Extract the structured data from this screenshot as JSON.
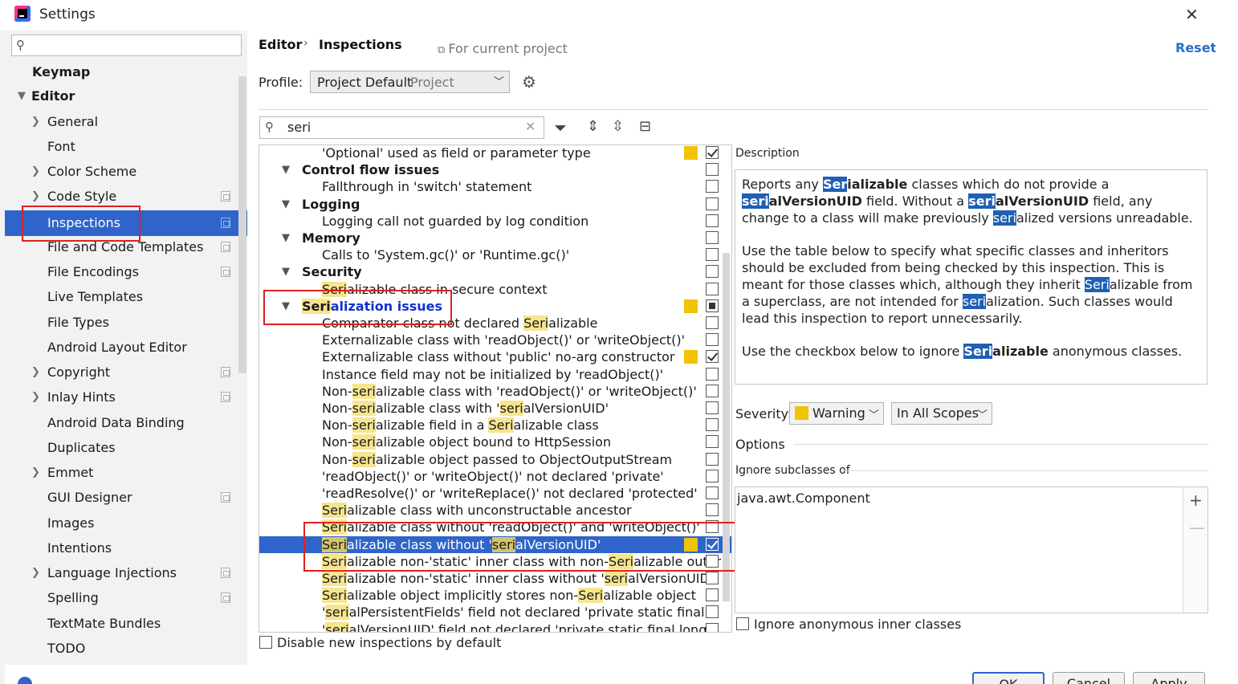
{
  "window": {
    "title": "Settings",
    "close": "✕"
  },
  "sidebar": {
    "search_placeholder": "",
    "items": [
      {
        "label": "Keymap"
      },
      {
        "label": "Editor"
      },
      {
        "label": "General"
      },
      {
        "label": "Font"
      },
      {
        "label": "Color Scheme"
      },
      {
        "label": "Code Style"
      },
      {
        "label": "Inspections"
      },
      {
        "label": "File and Code Templates"
      },
      {
        "label": "File Encodings"
      },
      {
        "label": "Live Templates"
      },
      {
        "label": "File Types"
      },
      {
        "label": "Android Layout Editor"
      },
      {
        "label": "Copyright"
      },
      {
        "label": "Inlay Hints"
      },
      {
        "label": "Android Data Binding"
      },
      {
        "label": "Duplicates"
      },
      {
        "label": "Emmet"
      },
      {
        "label": "GUI Designer"
      },
      {
        "label": "Images"
      },
      {
        "label": "Intentions"
      },
      {
        "label": "Language Injections"
      },
      {
        "label": "Spelling"
      },
      {
        "label": "TextMate Bundles"
      },
      {
        "label": "TODO"
      }
    ]
  },
  "header": {
    "breadcrumb_editor": "Editor",
    "breadcrumb_sep": "›",
    "breadcrumb_inspections": "Inspections",
    "for_current_project": "For current project",
    "reset": "Reset",
    "profile_label": "Profile:",
    "profile_value": "Project Default",
    "profile_scope": "Project"
  },
  "filter": {
    "value": "seri"
  },
  "tree": {
    "rows": [
      {
        "pre": "'Optional' used as field or parameter type",
        "hl": "",
        "post": ""
      },
      {
        "pre": "Control flow issues",
        "hl": "",
        "post": ""
      },
      {
        "pre": "Fallthrough in 'switch' statement",
        "hl": "",
        "post": ""
      },
      {
        "pre": "Logging",
        "hl": "",
        "post": ""
      },
      {
        "pre": "Logging call not guarded by log condition",
        "hl": "",
        "post": ""
      },
      {
        "pre": "Memory",
        "hl": "",
        "post": ""
      },
      {
        "pre": "Calls to 'System.gc()' or 'Runtime.gc()'",
        "hl": "",
        "post": ""
      },
      {
        "pre": "Security",
        "hl": "",
        "post": ""
      },
      {
        "pre": "",
        "hl": "Seri",
        "post": "alizable class in secure context"
      },
      {
        "pre": "",
        "hl": "Seri",
        "post": "alization issues"
      },
      {
        "pre": "Comparator class not declared ",
        "hl": "Seri",
        "post": "alizable"
      },
      {
        "pre": "Externalizable class with 'readObject()' or 'writeObject()'",
        "hl": "",
        "post": ""
      },
      {
        "pre": "Externalizable class without 'public' no-arg constructor",
        "hl": "",
        "post": ""
      },
      {
        "pre": "Instance field may not be initialized by 'readObject()'",
        "hl": "",
        "post": ""
      },
      {
        "pre": "Non-",
        "hl": "seri",
        "post": "alizable class with 'readObject()' or 'writeObject()'"
      },
      {
        "pre": "Non-",
        "hl": "seri",
        "post": "alizable class with '",
        "hl2": "seri",
        "post2": "alVersionUID'"
      },
      {
        "pre": "Non-",
        "hl": "seri",
        "post": "alizable field in a ",
        "hl2": "Seri",
        "post2": "alizable class"
      },
      {
        "pre": "Non-",
        "hl": "seri",
        "post": "alizable object bound to HttpSession"
      },
      {
        "pre": "Non-",
        "hl": "seri",
        "post": "alizable object passed to ObjectOutputStream"
      },
      {
        "pre": "'readObject()' or 'writeObject()' not declared 'private'",
        "hl": "",
        "post": ""
      },
      {
        "pre": "'readResolve()' or 'writeReplace()' not declared 'protected'",
        "hl": "",
        "post": ""
      },
      {
        "pre": "",
        "hl": "Seri",
        "post": "alizable class with unconstructable ancestor"
      },
      {
        "pre": "",
        "hl": "Seri",
        "post": "alizable class without 'readObject()' and 'writeObject()'"
      },
      {
        "pre": "",
        "hl": "Seri",
        "post": "alizable class without '",
        "hl2": "seri",
        "post2": "alVersionUID'"
      },
      {
        "pre": "",
        "hl": "Seri",
        "post": "alizable non-'static' inner class with non-",
        "hl2": "Seri",
        "post2": "alizable outer"
      },
      {
        "pre": "",
        "hl": "Seri",
        "post": "alizable non-'static' inner class without '",
        "hl2": "seri",
        "post2": "alVersionUID'"
      },
      {
        "pre": "",
        "hl": "Seri",
        "post": "alizable object implicitly stores non-",
        "hl2": "Seri",
        "post2": "alizable object"
      },
      {
        "pre": "'",
        "hl": "seri",
        "post": "alPersistentFields' field not declared 'private static final O"
      },
      {
        "pre": "'",
        "hl": "seri",
        "post": "alVersionUID' field not declared 'private static final long'"
      }
    ]
  },
  "disable_new": "Disable new inspections by default",
  "description": {
    "title": "Description",
    "p1": [
      "Reports any ",
      "Ser",
      "ializable",
      " classes which do not provide a ",
      "seri",
      "alVersionUID",
      " field. Without a ",
      "seri",
      "alVersionUID",
      " field, any change to a class will make previously ",
      "seri",
      "alized versions unreadable."
    ],
    "p2": [
      "Use the table below to specify what specific classes and inheritors should be excluded from being checked by this inspection. This is meant for those classes which, although they inherit ",
      "Seri",
      "alizable from a superclass, are not intended for ",
      "seri",
      "alization. Such classes would lead this inspection to report unnecessarily."
    ],
    "p3": [
      "Use the checkbox below to ignore ",
      "Seri",
      "alizable",
      " anonymous classes."
    ]
  },
  "severity": {
    "label": "Severity:",
    "value": "Warning",
    "scope": "In All Scopes",
    "color": "#f0c400"
  },
  "options": {
    "label": "Options",
    "ignore_label": "Ignore subclasses of",
    "list": [
      "java.awt.Component"
    ],
    "plus": "+",
    "minus": "—",
    "anon_label": "Ignore anonymous inner classes"
  },
  "buttons": {
    "ok": "OK",
    "cancel": "Cancel",
    "apply": "Apply"
  },
  "colors": {
    "selection": "#2f65ca",
    "highlight": "#f6e58f",
    "warning": "#f0c400",
    "link": "#2a6ec9",
    "annotation": "#e02020"
  }
}
